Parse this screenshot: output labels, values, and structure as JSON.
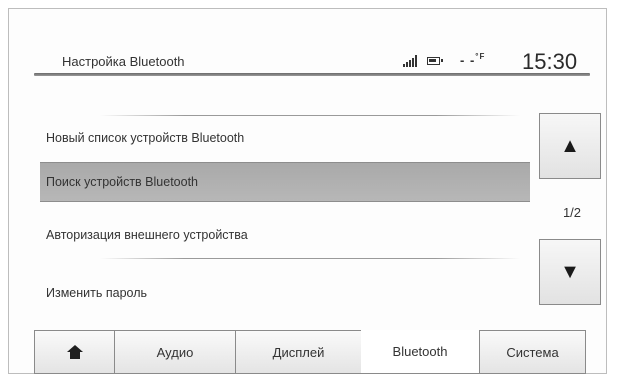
{
  "header": {
    "title": "Настройка Bluetooth",
    "temperature": "- -",
    "temperature_unit": "°F",
    "time": "15:30",
    "icons": [
      "signal-strength-icon",
      "battery-icon"
    ]
  },
  "list": {
    "items": [
      {
        "label": "Новый список устройств Bluetooth",
        "selected": false
      },
      {
        "label": "Поиск устройств Bluetooth",
        "selected": true
      },
      {
        "label": "Авторизация внешнего устройства",
        "selected": false
      },
      {
        "label": "Изменить пароль",
        "selected": false
      }
    ]
  },
  "scroll": {
    "up_icon": "▲",
    "down_icon": "▼",
    "page": "1/2"
  },
  "tabs": [
    {
      "id": "home",
      "label": "",
      "icon": "home-icon",
      "active": false
    },
    {
      "id": "audio",
      "label": "Аудио",
      "active": false
    },
    {
      "id": "display",
      "label": "Дисплей",
      "active": false
    },
    {
      "id": "bluetooth",
      "label": "Bluetooth",
      "active": true
    },
    {
      "id": "system",
      "label": "Система",
      "active": false
    }
  ],
  "colors": {
    "selected_row": "#b0b0b0",
    "header_line": "#7a7a7a",
    "button_border": "#8a8a8a"
  }
}
